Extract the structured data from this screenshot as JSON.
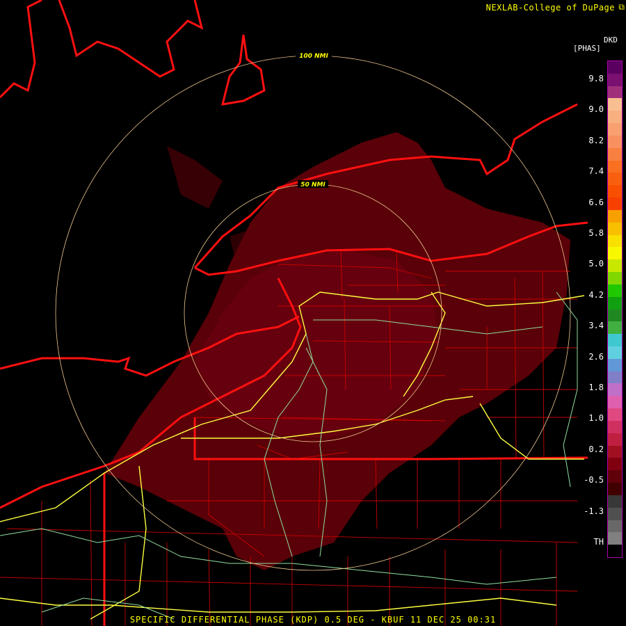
{
  "header": {
    "credit": "NEXLAB-College of DuPage",
    "credit_icon": "external-link-icon"
  },
  "legend": {
    "product": "DKD",
    "units": "[PHAS]",
    "ticks": [
      "9.8",
      "9.0",
      "8.2",
      "7.4",
      "6.6",
      "5.8",
      "5.0",
      "4.2",
      "3.4",
      "2.6",
      "1.8",
      "1.0",
      "0.2",
      "-0.5",
      "-1.3",
      "TH"
    ],
    "colors": [
      "#5a0060",
      "#7a1070",
      "#a0307a",
      "#f8c090",
      "#f8b080",
      "#f8a070",
      "#f89060",
      "#f88040",
      "#f87020",
      "#f86010",
      "#f85000",
      "#f84000",
      "#f8a000",
      "#f8c000",
      "#f8e000",
      "#f8f800",
      "#c8e800",
      "#80d800",
      "#20c800",
      "#10a010",
      "#208820",
      "#40b040",
      "#40c8d0",
      "#60d0e0",
      "#6098d8",
      "#8080c8",
      "#c070c8",
      "#e060b0",
      "#e04880",
      "#d03060",
      "#c02040",
      "#a01020",
      "#800010",
      "#600008",
      "#400000",
      "#383838",
      "#505050",
      "#686868",
      "#808080",
      "#000000"
    ],
    "border_color": "#b000b0"
  },
  "rings": [
    {
      "label": "100 NMI"
    },
    {
      "label": "50 NMI"
    }
  ],
  "map_colors": {
    "coast": "#ff1010",
    "county": "#c80000",
    "interstate": "#ffff40",
    "highway": "#90e0a0",
    "ring": "#f0c890",
    "echo": "#5a0008"
  },
  "footer": {
    "caption": "SPECIFIC DIFFERENTIAL PHASE (KDP) 0.5 DEG - KBUF 11 DEC 25 00:31"
  }
}
